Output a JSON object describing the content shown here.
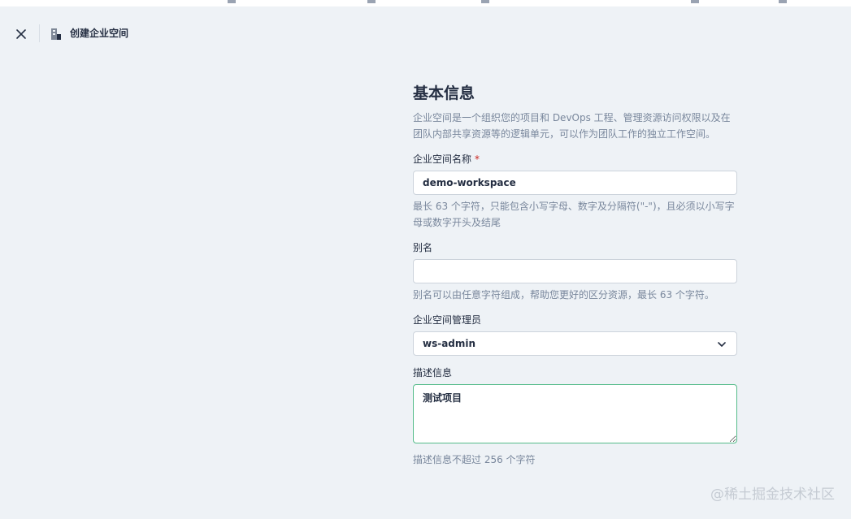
{
  "header": {
    "title": "创建企业空间"
  },
  "form": {
    "section_title": "基本信息",
    "section_desc": "企业空间是一个组织您的项目和 DevOps 工程、管理资源访问权限以及在团队内部共享资源等的逻辑单元，可以作为团队工作的独立工作空间。",
    "name": {
      "label": "企业空间名称",
      "required_mark": "*",
      "value": "demo-workspace",
      "hint": "最长 63 个字符，只能包含小写字母、数字及分隔符(\"-\")，且必须以小写字母或数字开头及结尾"
    },
    "alias": {
      "label": "别名",
      "value": "",
      "hint": "别名可以由任意字符组成，帮助您更好的区分资源，最长 63 个字符。"
    },
    "admin": {
      "label": "企业空间管理员",
      "value": "ws-admin"
    },
    "description": {
      "label": "描述信息",
      "value": "测试项目",
      "hint": "描述信息不超过 256 个字符"
    }
  },
  "watermark": "@稀土掘金技术社区"
}
